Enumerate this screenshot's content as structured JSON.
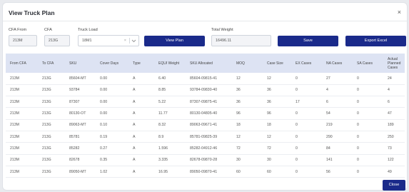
{
  "modal": {
    "title": "View Truck Plan",
    "close_icon": "×"
  },
  "filters": {
    "cfa_from": {
      "label": "CFA From",
      "value": "213M"
    },
    "cfa": {
      "label": "CFA",
      "value": "213G"
    },
    "truck_load": {
      "label": "Truck Load",
      "value": "18M1",
      "clear": "×"
    },
    "total_weight": {
      "label": "Total Weight",
      "value": "16496.11"
    }
  },
  "buttons": {
    "view_plan": "View Plan",
    "save": "Save",
    "export_excel": "Export Excel",
    "close": "Close"
  },
  "table": {
    "headers": [
      "From CFA",
      "To CFA",
      "SKU",
      "Cover Days",
      "Type",
      "EQUI Weight",
      "SKU Allocated",
      "MOQ",
      "Case Size",
      "EX Cases",
      "NA Cases",
      "SA Cases",
      "Actual Planned Cases"
    ],
    "rows": [
      [
        "213M",
        "213G",
        "85604-MT",
        "0.00",
        "A",
        "6.40",
        "85604-09815-41",
        "12",
        "12",
        "0",
        "27",
        "0",
        "24"
      ],
      [
        "213M",
        "213G",
        "93784",
        "0.00",
        "A",
        "8.85",
        "93784-09830-40",
        "36",
        "36",
        "0",
        "4",
        "0",
        "4"
      ],
      [
        "213M",
        "213G",
        "87307",
        "0.00",
        "A",
        "5.22",
        "87307-09875-41",
        "36",
        "36",
        "17",
        "6",
        "0",
        "6"
      ],
      [
        "213M",
        "213G",
        "80130-OT",
        "0.00",
        "A",
        "11.77",
        "80130-04805-40",
        "96",
        "96",
        "0",
        "54",
        "0",
        "47"
      ],
      [
        "213M",
        "213G",
        "89063-MT",
        "0.10",
        "A",
        "8.32",
        "89063-09671-41",
        "18",
        "18",
        "0",
        "219",
        "0",
        "189"
      ],
      [
        "213M",
        "213G",
        "85781",
        "0.19",
        "A",
        "8.9",
        "85781-09825-39",
        "12",
        "12",
        "0",
        "290",
        "0",
        "250"
      ],
      [
        "213M",
        "213G",
        "85282",
        "0.27",
        "A",
        "1.596",
        "85282-04912-46",
        "72",
        "72",
        "0",
        "84",
        "0",
        "73"
      ],
      [
        "213M",
        "213G",
        "82678",
        "0.35",
        "A",
        "3.335",
        "82678-09870-28",
        "30",
        "30",
        "0",
        "141",
        "0",
        "122"
      ],
      [
        "213M",
        "213G",
        "89050-MT",
        "1.02",
        "A",
        "16.95",
        "89050-09870-41",
        "60",
        "60",
        "0",
        "56",
        "0",
        "49"
      ]
    ]
  }
}
